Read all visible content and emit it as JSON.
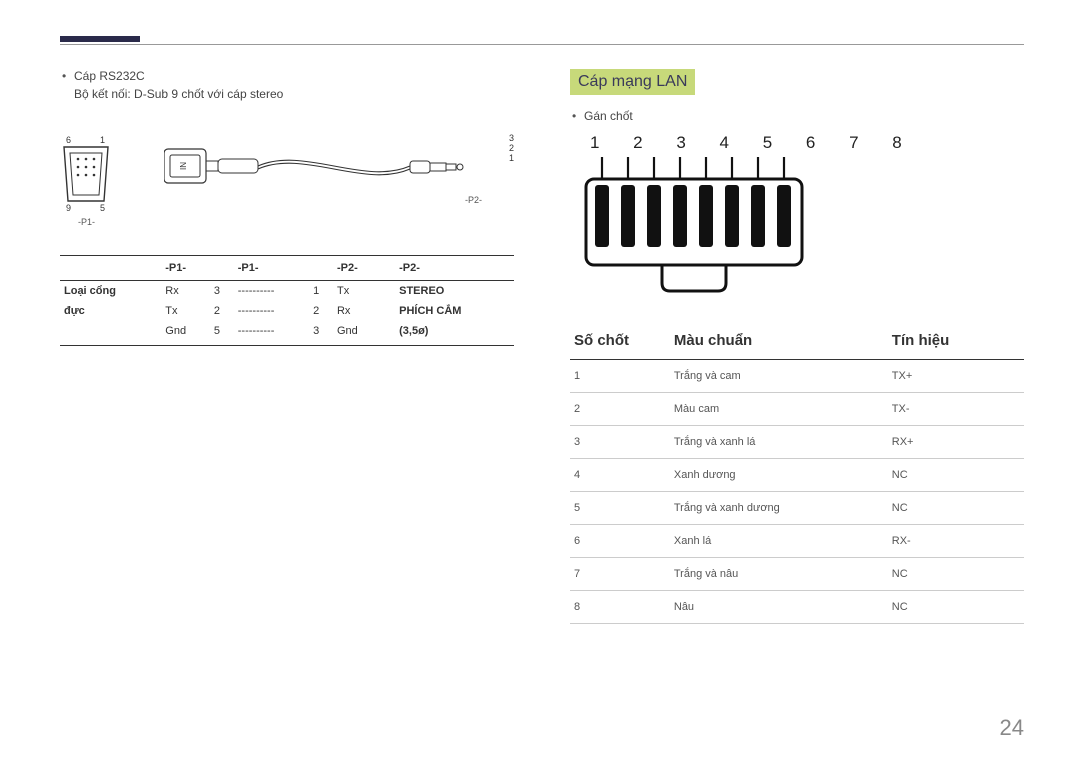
{
  "page_number": "24",
  "left": {
    "bullet": "Cáp RS232C",
    "subtext": "Bộ kết nối: D-Sub 9 chốt với cáp stereo",
    "dsub_nums": {
      "tl": "6",
      "tr": "1",
      "bl": "9",
      "br": "5"
    },
    "p1_label": "-P1-",
    "p2_label": "-P2-",
    "plug_nums": {
      "a": "3",
      "b": "2",
      "c": "1"
    },
    "table": {
      "head": [
        "",
        "-P1-",
        "",
        "-P1-",
        "",
        "-P2-",
        "",
        "-P2-"
      ],
      "rowhead": [
        "Loại cổng",
        "đực",
        ""
      ],
      "rows": [
        [
          "Rx",
          "3",
          "----------",
          "1",
          "Tx",
          "STEREO"
        ],
        [
          "Tx",
          "2",
          "----------",
          "2",
          "Rx",
          "PHÍCH CẮM"
        ],
        [
          "Gnd",
          "5",
          "----------",
          "3",
          "Gnd",
          "(3,5ø)"
        ]
      ]
    }
  },
  "right": {
    "section_title": "Cáp mạng LAN",
    "bullet": "Gán chốt",
    "pin_numbers": "1 2 3 4 5 6 7 8",
    "table": {
      "head": [
        "Số chốt",
        "Màu chuẩn",
        "Tín hiệu"
      ],
      "rows": [
        [
          "1",
          "Trắng và cam",
          "TX+"
        ],
        [
          "2",
          "Màu cam",
          "TX-"
        ],
        [
          "3",
          "Trắng và xanh lá",
          "RX+"
        ],
        [
          "4",
          "Xanh dương",
          "NC"
        ],
        [
          "5",
          "Trắng và xanh dương",
          "NC"
        ],
        [
          "6",
          "Xanh lá",
          "RX-"
        ],
        [
          "7",
          "Trắng và nâu",
          "NC"
        ],
        [
          "8",
          "Nâu",
          "NC"
        ]
      ]
    }
  }
}
